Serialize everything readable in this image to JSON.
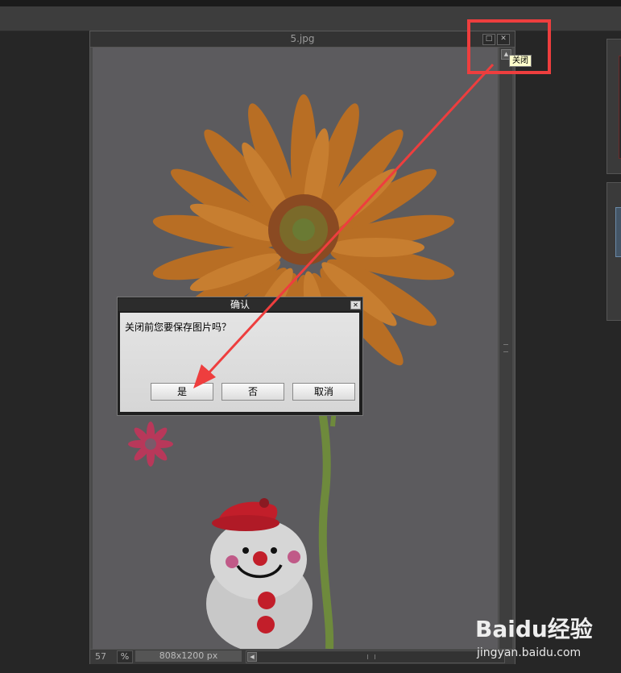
{
  "document": {
    "title": "5.jpg",
    "zoom_value": "57",
    "zoom_unit": "%",
    "dimensions": "808x1200 px"
  },
  "tooltip": {
    "text": "关闭"
  },
  "dialog": {
    "title": "确认",
    "message": "关闭前您要保存图片吗？",
    "yes_label": "是",
    "no_label": "否",
    "cancel_label": "取消"
  },
  "watermark": {
    "logo_text": "Baidu经验",
    "url": "jingyan.baidu.com"
  },
  "colors": {
    "annotation_red": "#ee3e3e",
    "workspace_bg": "#262626",
    "dialog_body": "#dcdcdc"
  },
  "icons": [
    "maximize-icon",
    "close-icon",
    "scroll-up-icon",
    "scroll-left-icon",
    "dialog-close-icon",
    "gerbera-flower-image",
    "snowman-image",
    "paw-logo"
  ]
}
